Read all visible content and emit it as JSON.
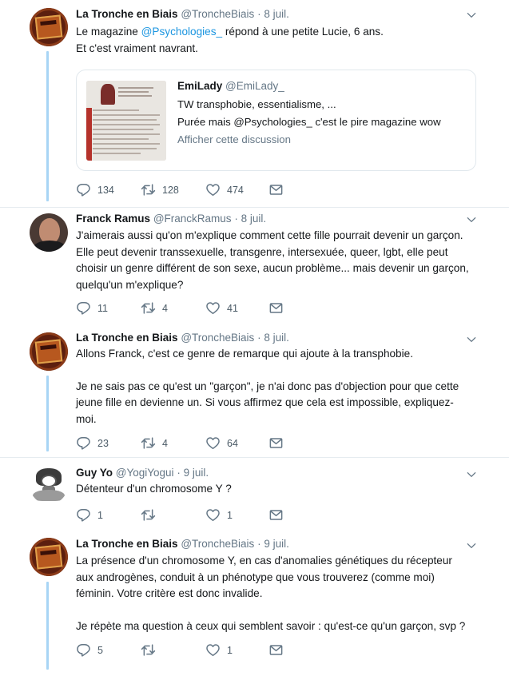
{
  "colors": {
    "link": "#1b95e0",
    "muted": "#657786",
    "thread_line": "#a8d5f5"
  },
  "icons": [
    "reply-icon",
    "retweet-icon",
    "like-icon",
    "dm-icon",
    "chevron-down-icon"
  ],
  "tweets": [
    {
      "name": "La Tronche en Biais",
      "handle": "@TroncheBiais",
      "dot": "·",
      "date": "8 juil.",
      "text_before": "Le magazine ",
      "mention": "@Psychologies_",
      "text_after": " répond à une petite Lucie, 6 ans.",
      "line2": "Et c'est vraiment navrant.",
      "quote": {
        "name": "EmiLady",
        "handle": "@EmiLady_",
        "line1": "TW transphobie, essentialisme, ...",
        "line2": "Purée mais @Psychologies_ c'est le pire magazine wow",
        "show_thread": "Afficher cette discussion"
      },
      "replies": "134",
      "retweets": "128",
      "likes": "474"
    },
    {
      "name": "Franck Ramus",
      "handle": "@FranckRamus",
      "dot": "·",
      "date": "8 juil.",
      "lines": [
        "J'aimerais aussi qu'on m'explique comment cette fille pourrait devenir un garçon.",
        "Elle peut devenir transsexuelle, transgenre, intersexuée, queer, lgbt, elle peut",
        "choisir un genre différent de son sexe, aucun problème... mais devenir un garçon,",
        "quelqu'un m'explique?"
      ],
      "replies": "11",
      "retweets": "4",
      "likes": "41"
    },
    {
      "name": "La Tronche en Biais",
      "handle": "@TroncheBiais",
      "dot": "·",
      "date": "8 juil.",
      "lines": [
        "Allons Franck, c'est ce genre de remarque qui ajoute à la transphobie.",
        "Je ne sais pas ce qu'est un \"garçon\", je n'ai donc pas d'objection pour que cette",
        "jeune fille en devienne un.  Si vous affirmez que cela est impossible, expliquez-",
        "moi."
      ],
      "replies": "23",
      "retweets": "4",
      "likes": "64"
    },
    {
      "name": "Guy Yo",
      "handle": "@YogiYogui",
      "dot": "·",
      "date": "9 juil.",
      "lines": [
        "Détenteur d'un chromosome Y ?"
      ],
      "replies": "1",
      "retweets": "",
      "likes": "1"
    },
    {
      "name": "La Tronche en Biais",
      "handle": "@TroncheBiais",
      "dot": "·",
      "date": "9 juil.",
      "lines": [
        "La présence d'un chromosome Y, en cas d'anomalies génétiques du récepteur",
        "aux androgènes, conduit à un phénotype que vous trouverez (comme moi)",
        "féminin. Votre critère est donc invalide.",
        "Je répète ma question à ceux qui semblent savoir : qu'est-ce qu'un garçon, svp ?"
      ],
      "replies": "5",
      "retweets": "",
      "likes": "1"
    }
  ]
}
